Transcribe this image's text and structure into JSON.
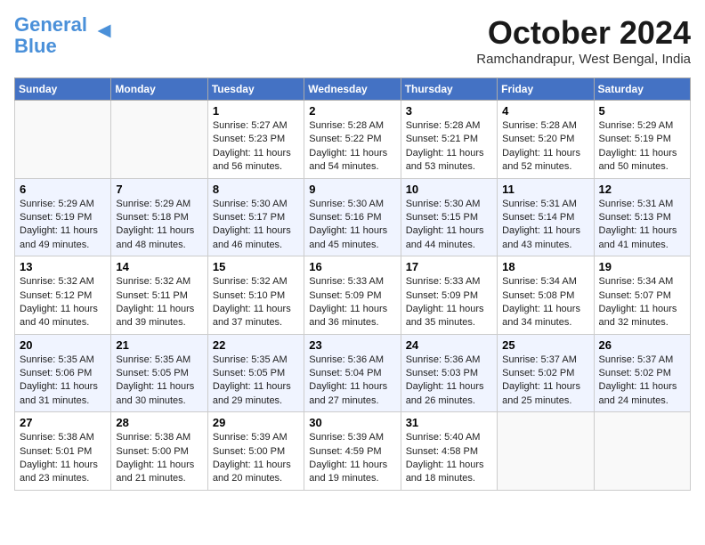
{
  "header": {
    "logo_line1": "General",
    "logo_line2": "Blue",
    "month": "October 2024",
    "location": "Ramchandrapur, West Bengal, India"
  },
  "weekdays": [
    "Sunday",
    "Monday",
    "Tuesday",
    "Wednesday",
    "Thursday",
    "Friday",
    "Saturday"
  ],
  "weeks": [
    [
      {
        "day": "",
        "info": ""
      },
      {
        "day": "",
        "info": ""
      },
      {
        "day": "1",
        "info": "Sunrise: 5:27 AM\nSunset: 5:23 PM\nDaylight: 11 hours and 56 minutes."
      },
      {
        "day": "2",
        "info": "Sunrise: 5:28 AM\nSunset: 5:22 PM\nDaylight: 11 hours and 54 minutes."
      },
      {
        "day": "3",
        "info": "Sunrise: 5:28 AM\nSunset: 5:21 PM\nDaylight: 11 hours and 53 minutes."
      },
      {
        "day": "4",
        "info": "Sunrise: 5:28 AM\nSunset: 5:20 PM\nDaylight: 11 hours and 52 minutes."
      },
      {
        "day": "5",
        "info": "Sunrise: 5:29 AM\nSunset: 5:19 PM\nDaylight: 11 hours and 50 minutes."
      }
    ],
    [
      {
        "day": "6",
        "info": "Sunrise: 5:29 AM\nSunset: 5:19 PM\nDaylight: 11 hours and 49 minutes."
      },
      {
        "day": "7",
        "info": "Sunrise: 5:29 AM\nSunset: 5:18 PM\nDaylight: 11 hours and 48 minutes."
      },
      {
        "day": "8",
        "info": "Sunrise: 5:30 AM\nSunset: 5:17 PM\nDaylight: 11 hours and 46 minutes."
      },
      {
        "day": "9",
        "info": "Sunrise: 5:30 AM\nSunset: 5:16 PM\nDaylight: 11 hours and 45 minutes."
      },
      {
        "day": "10",
        "info": "Sunrise: 5:30 AM\nSunset: 5:15 PM\nDaylight: 11 hours and 44 minutes."
      },
      {
        "day": "11",
        "info": "Sunrise: 5:31 AM\nSunset: 5:14 PM\nDaylight: 11 hours and 43 minutes."
      },
      {
        "day": "12",
        "info": "Sunrise: 5:31 AM\nSunset: 5:13 PM\nDaylight: 11 hours and 41 minutes."
      }
    ],
    [
      {
        "day": "13",
        "info": "Sunrise: 5:32 AM\nSunset: 5:12 PM\nDaylight: 11 hours and 40 minutes."
      },
      {
        "day": "14",
        "info": "Sunrise: 5:32 AM\nSunset: 5:11 PM\nDaylight: 11 hours and 39 minutes."
      },
      {
        "day": "15",
        "info": "Sunrise: 5:32 AM\nSunset: 5:10 PM\nDaylight: 11 hours and 37 minutes."
      },
      {
        "day": "16",
        "info": "Sunrise: 5:33 AM\nSunset: 5:09 PM\nDaylight: 11 hours and 36 minutes."
      },
      {
        "day": "17",
        "info": "Sunrise: 5:33 AM\nSunset: 5:09 PM\nDaylight: 11 hours and 35 minutes."
      },
      {
        "day": "18",
        "info": "Sunrise: 5:34 AM\nSunset: 5:08 PM\nDaylight: 11 hours and 34 minutes."
      },
      {
        "day": "19",
        "info": "Sunrise: 5:34 AM\nSunset: 5:07 PM\nDaylight: 11 hours and 32 minutes."
      }
    ],
    [
      {
        "day": "20",
        "info": "Sunrise: 5:35 AM\nSunset: 5:06 PM\nDaylight: 11 hours and 31 minutes."
      },
      {
        "day": "21",
        "info": "Sunrise: 5:35 AM\nSunset: 5:05 PM\nDaylight: 11 hours and 30 minutes."
      },
      {
        "day": "22",
        "info": "Sunrise: 5:35 AM\nSunset: 5:05 PM\nDaylight: 11 hours and 29 minutes."
      },
      {
        "day": "23",
        "info": "Sunrise: 5:36 AM\nSunset: 5:04 PM\nDaylight: 11 hours and 27 minutes."
      },
      {
        "day": "24",
        "info": "Sunrise: 5:36 AM\nSunset: 5:03 PM\nDaylight: 11 hours and 26 minutes."
      },
      {
        "day": "25",
        "info": "Sunrise: 5:37 AM\nSunset: 5:02 PM\nDaylight: 11 hours and 25 minutes."
      },
      {
        "day": "26",
        "info": "Sunrise: 5:37 AM\nSunset: 5:02 PM\nDaylight: 11 hours and 24 minutes."
      }
    ],
    [
      {
        "day": "27",
        "info": "Sunrise: 5:38 AM\nSunset: 5:01 PM\nDaylight: 11 hours and 23 minutes."
      },
      {
        "day": "28",
        "info": "Sunrise: 5:38 AM\nSunset: 5:00 PM\nDaylight: 11 hours and 21 minutes."
      },
      {
        "day": "29",
        "info": "Sunrise: 5:39 AM\nSunset: 5:00 PM\nDaylight: 11 hours and 20 minutes."
      },
      {
        "day": "30",
        "info": "Sunrise: 5:39 AM\nSunset: 4:59 PM\nDaylight: 11 hours and 19 minutes."
      },
      {
        "day": "31",
        "info": "Sunrise: 5:40 AM\nSunset: 4:58 PM\nDaylight: 11 hours and 18 minutes."
      },
      {
        "day": "",
        "info": ""
      },
      {
        "day": "",
        "info": ""
      }
    ]
  ]
}
